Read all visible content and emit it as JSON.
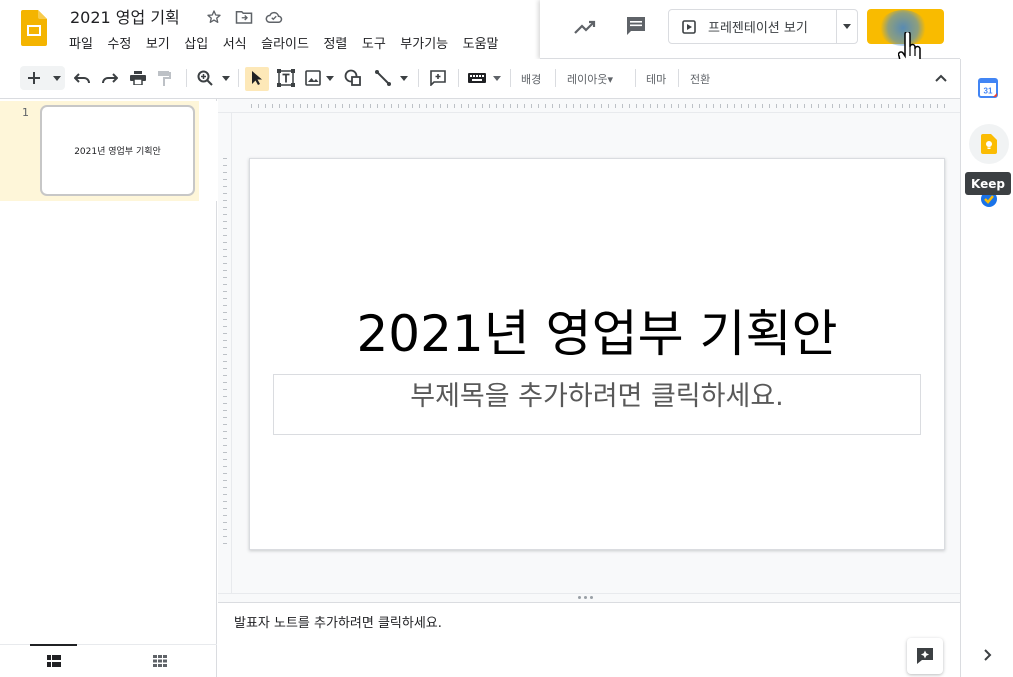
{
  "header": {
    "doc_title": "2021 영업 기획",
    "menu": [
      "파일",
      "수정",
      "보기",
      "삽입",
      "서식",
      "슬라이드",
      "정렬",
      "도구",
      "부가기능",
      "도움말"
    ],
    "present_label": "프레젠테이션 보기",
    "share_color": "#f9bb00"
  },
  "toolbar": {
    "background_label": "배경",
    "layout_label": "레이아웃▾",
    "theme_label": "테마",
    "transition_label": "전환"
  },
  "filmstrip": {
    "slide_number": "1",
    "thumb_title": "2021년 영업부 기획안"
  },
  "slide": {
    "title": "2021년 영업부 기획안",
    "subtitle_placeholder": "부제목을 추가하려면 클릭하세요."
  },
  "notes": {
    "placeholder": "발표자 노트를 추가하려면 클릭하세요."
  },
  "side_panel": {
    "calendar_day": "31",
    "keep_tooltip": "Keep"
  },
  "icons": [
    "slides-logo-icon",
    "star-icon",
    "move-folder-icon",
    "cloud-status-icon",
    "activity-trend-icon",
    "comment-icon",
    "play-icon",
    "dropdown-arrow-icon",
    "avatar-icon",
    "hand-cursor-icon",
    "plus-icon",
    "undo-icon",
    "redo-icon",
    "print-icon",
    "paint-format-icon",
    "zoom-icon",
    "select-arrow-icon",
    "text-box-icon",
    "image-icon",
    "shape-icon",
    "line-icon",
    "add-comment-icon",
    "keyboard-icon",
    "collapse-icon",
    "filmstrip-view-icon",
    "grid-view-icon",
    "explore-icon",
    "calendar-icon",
    "keep-icon",
    "tasks-icon",
    "expand-panel-icon"
  ]
}
